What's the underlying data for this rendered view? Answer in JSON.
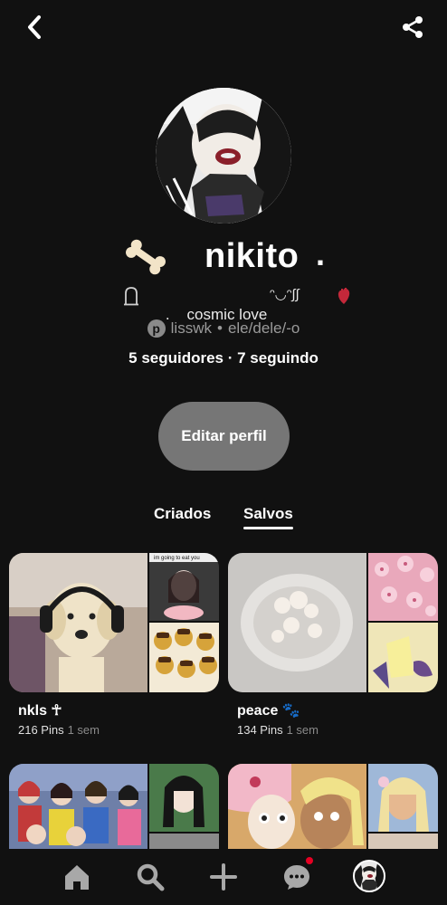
{
  "header": {
    "back_icon": "chevron-left-icon",
    "share_icon": "share-icon"
  },
  "profile": {
    "name": "nikito",
    "name_suffix": ".",
    "name_emoji": "bone-emoji",
    "bio_prefix": ".",
    "bio_text": "cosmic love",
    "bio_decoration": "ᵔ◡ᵔ∫∫",
    "bio_icons": [
      "headstone-icon",
      "anatomical-heart-icon"
    ],
    "username": "lisswk",
    "pronouns": "ele/dele/-o",
    "meta_separator": "•",
    "stats": "5 seguidores · 7 seguindo",
    "edit_label": "Editar perfil"
  },
  "tabs": [
    {
      "label": "Criados",
      "active": false
    },
    {
      "label": "Salvos",
      "active": true
    }
  ],
  "boards": [
    {
      "title": "nkls ☥",
      "pins": "216 Pins",
      "time": "1 sem",
      "cover_caption": "im going to eat you"
    },
    {
      "title": "peace 🐾",
      "pins": "134 Pins",
      "time": "1 sem"
    },
    {
      "title": "",
      "pins": "",
      "time": ""
    },
    {
      "title": "",
      "pins": "",
      "time": ""
    }
  ],
  "navbar": {
    "items": [
      "home-icon",
      "search-icon",
      "create-icon",
      "messages-icon",
      "profile-avatar"
    ],
    "notification_color": "#e60023"
  },
  "colors": {
    "background": "#111111",
    "button": "#767676",
    "muted_text": "#9a9a9a",
    "accent_red": "#e60023"
  }
}
